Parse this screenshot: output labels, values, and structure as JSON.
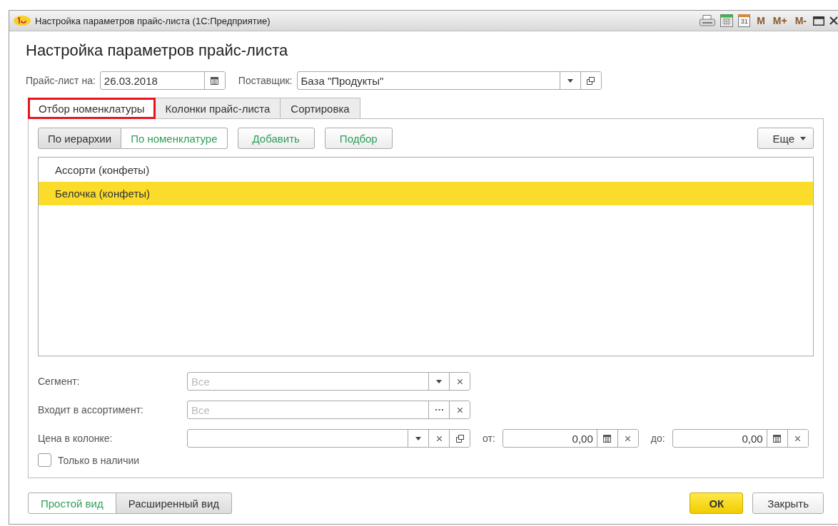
{
  "window": {
    "title": "Настройка параметров прайс-листа  (1С:Предприятие)",
    "title_tools": [
      {
        "kind": "print"
      },
      {
        "kind": "calculator"
      },
      {
        "kind": "calendar",
        "label": "31"
      },
      {
        "kind": "text",
        "label": "M"
      },
      {
        "kind": "text",
        "label": "M+"
      },
      {
        "kind": "text",
        "label": "M-"
      },
      {
        "kind": "maximize"
      },
      {
        "kind": "close"
      }
    ]
  },
  "heading": "Настройка параметров прайс-листа",
  "header_fields": [
    {
      "label": "Прайс-лист на:",
      "value": "26.03.2018",
      "buttons": [
        {
          "kind": "calendar"
        }
      ]
    },
    {
      "label": "Поставщик:",
      "value": "База \"Продукты\"",
      "buttons": [
        {
          "kind": "dropdown"
        },
        {
          "kind": "open"
        }
      ]
    }
  ],
  "tabs": [
    {
      "label": "Отбор номенклатуры",
      "selected": true,
      "highlighted": true
    },
    {
      "label": "Колонки прайс-листа",
      "selected": false,
      "highlighted": false
    },
    {
      "label": "Сортировка",
      "selected": false,
      "highlighted": false
    }
  ],
  "list_toolbar": {
    "view_toggle": [
      {
        "label": "По иерархии",
        "selected": true
      },
      {
        "label": "По номенклатуре",
        "selected": false
      }
    ],
    "buttons": [
      {
        "label": "Добавить"
      },
      {
        "label": "Подбор"
      }
    ],
    "more": {
      "label": "Еще"
    }
  },
  "list": [
    {
      "text": "Ассорти (конфеты)",
      "selected": false
    },
    {
      "text": "Белочка (конфеты)",
      "selected": true
    }
  ],
  "filters": [
    {
      "label": "Сегмент:",
      "placeholder": "Все",
      "buttons": [
        {
          "kind": "dropdown"
        },
        {
          "kind": "clear"
        }
      ]
    },
    {
      "label": "Входит в ассортимент:",
      "placeholder": "Все",
      "buttons": [
        {
          "kind": "select"
        },
        {
          "kind": "clear"
        }
      ]
    },
    {
      "label": "Цена в колонке:",
      "buttons": [
        {
          "kind": "dropdown"
        },
        {
          "kind": "clear"
        },
        {
          "kind": "open"
        }
      ],
      "ranges": [
        {
          "label": "от:",
          "value": "0,00",
          "buttons": [
            {
              "kind": "calculator"
            },
            {
              "kind": "clear"
            }
          ]
        },
        {
          "label": "до:",
          "value": "0,00",
          "buttons": [
            {
              "kind": "calculator"
            },
            {
              "kind": "clear"
            }
          ]
        }
      ]
    }
  ],
  "in_stock": {
    "label": "Только в наличии",
    "checked": false
  },
  "footer": {
    "view_modes": [
      {
        "label": "Простой вид",
        "selected": false
      },
      {
        "label": "Расширенный вид",
        "selected": true
      }
    ],
    "ok": {
      "label": "ОК"
    },
    "close": {
      "label": "Закрыть"
    }
  }
}
